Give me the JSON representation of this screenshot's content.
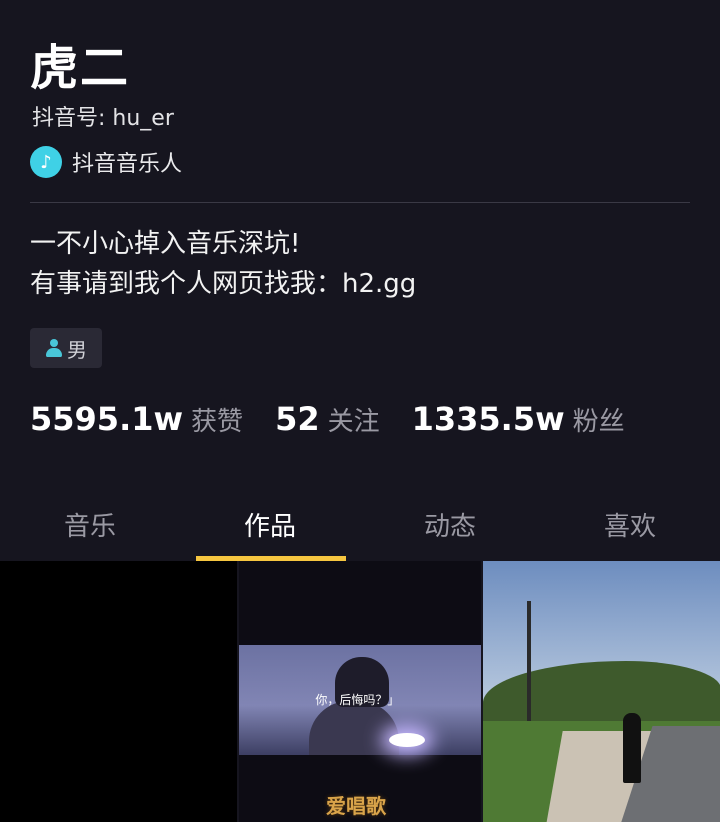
{
  "profile": {
    "name": "虎二",
    "douyin_id": "抖音号: hu_er",
    "badge_icon": "music-note-icon",
    "badge_text": "抖音音乐人",
    "bio_line1": "一不小心掉入音乐深坑!",
    "bio_line2": "有事请到我个人网页找我：h2.gg",
    "gender": "男",
    "gender_icon": "person-icon"
  },
  "stats": [
    {
      "value": "5595.1w",
      "label": "获赞"
    },
    {
      "value": "52",
      "label": "关注"
    },
    {
      "value": "1335.5w",
      "label": "粉丝"
    }
  ],
  "tabs": [
    "音乐",
    "作品",
    "动态",
    "喜欢"
  ],
  "active_tab": "作品",
  "videos": [
    {
      "caption": ""
    },
    {
      "caption": "你，后悔吗？」"
    },
    {
      "caption": ""
    }
  ],
  "watermark": "爱唱歌",
  "colors": {
    "background": "#16151f",
    "accent_underline": "#f6c640",
    "badge": "#3fd1e6",
    "muted_text": "#9a99a3"
  }
}
